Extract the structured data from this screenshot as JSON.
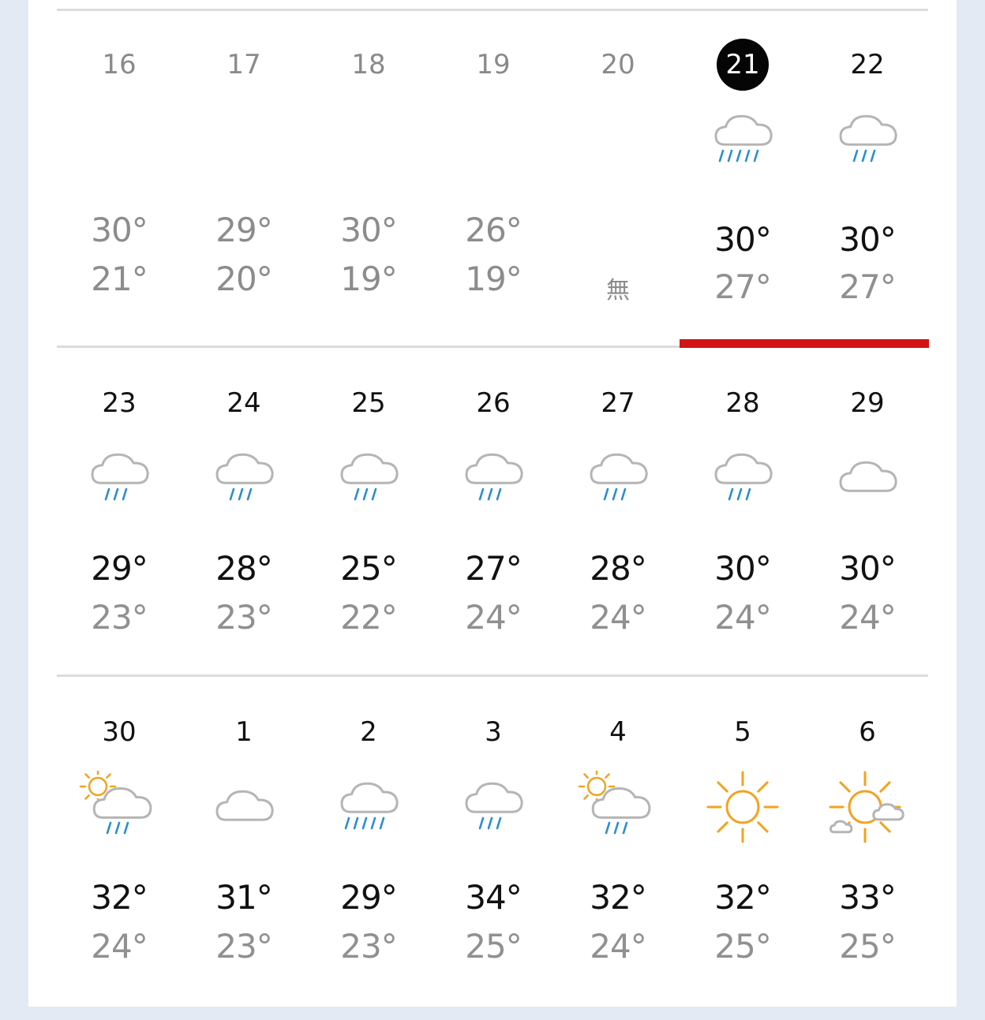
{
  "colors": {
    "today_marker": "#d21414",
    "rain": "#2a8fd0",
    "sun": "#f2a321",
    "cloud_stroke": "#b5b5b5",
    "high_temp": "#111111",
    "low_temp": "#909090"
  },
  "weeks": [
    {
      "days": [
        {
          "date": "16",
          "state": "past",
          "icon": "none",
          "high": "30°",
          "low": "21°"
        },
        {
          "date": "17",
          "state": "past",
          "icon": "none",
          "high": "29°",
          "low": "20°"
        },
        {
          "date": "18",
          "state": "past",
          "icon": "none",
          "high": "30°",
          "low": "19°"
        },
        {
          "date": "19",
          "state": "past",
          "icon": "none",
          "high": "26°",
          "low": "19°"
        },
        {
          "date": "20",
          "state": "past",
          "icon": "none",
          "high": "",
          "low": "",
          "no_data": "無"
        },
        {
          "date": "21",
          "state": "today",
          "icon": "heavy-rain-icon",
          "high": "30°",
          "low": "27°"
        },
        {
          "date": "22",
          "state": "future",
          "icon": "rain-icon",
          "high": "30°",
          "low": "27°"
        }
      ]
    },
    {
      "days": [
        {
          "date": "23",
          "state": "future",
          "icon": "rain-icon",
          "high": "29°",
          "low": "23°"
        },
        {
          "date": "24",
          "state": "future",
          "icon": "rain-icon",
          "high": "28°",
          "low": "23°"
        },
        {
          "date": "25",
          "state": "future",
          "icon": "rain-icon",
          "high": "25°",
          "low": "22°"
        },
        {
          "date": "26",
          "state": "future",
          "icon": "rain-icon",
          "high": "27°",
          "low": "24°"
        },
        {
          "date": "27",
          "state": "future",
          "icon": "rain-icon",
          "high": "28°",
          "low": "24°"
        },
        {
          "date": "28",
          "state": "future",
          "icon": "rain-icon",
          "high": "30°",
          "low": "24°"
        },
        {
          "date": "29",
          "state": "future",
          "icon": "cloud-icon",
          "high": "30°",
          "low": "24°"
        }
      ]
    },
    {
      "days": [
        {
          "date": "30",
          "state": "future",
          "icon": "sun-cloud-rain-icon",
          "high": "32°",
          "low": "24°"
        },
        {
          "date": "1",
          "state": "future",
          "icon": "cloud-icon",
          "high": "31°",
          "low": "23°"
        },
        {
          "date": "2",
          "state": "future",
          "icon": "heavy-rain-icon",
          "high": "29°",
          "low": "23°"
        },
        {
          "date": "3",
          "state": "future",
          "icon": "rain-icon",
          "high": "34°",
          "low": "25°"
        },
        {
          "date": "4",
          "state": "future",
          "icon": "sun-cloud-rain-icon",
          "high": "32°",
          "low": "24°"
        },
        {
          "date": "5",
          "state": "future",
          "icon": "sun-icon",
          "high": "32°",
          "low": "25°"
        },
        {
          "date": "6",
          "state": "future",
          "icon": "sun-small-clouds-icon",
          "high": "33°",
          "low": "25°"
        }
      ]
    }
  ]
}
